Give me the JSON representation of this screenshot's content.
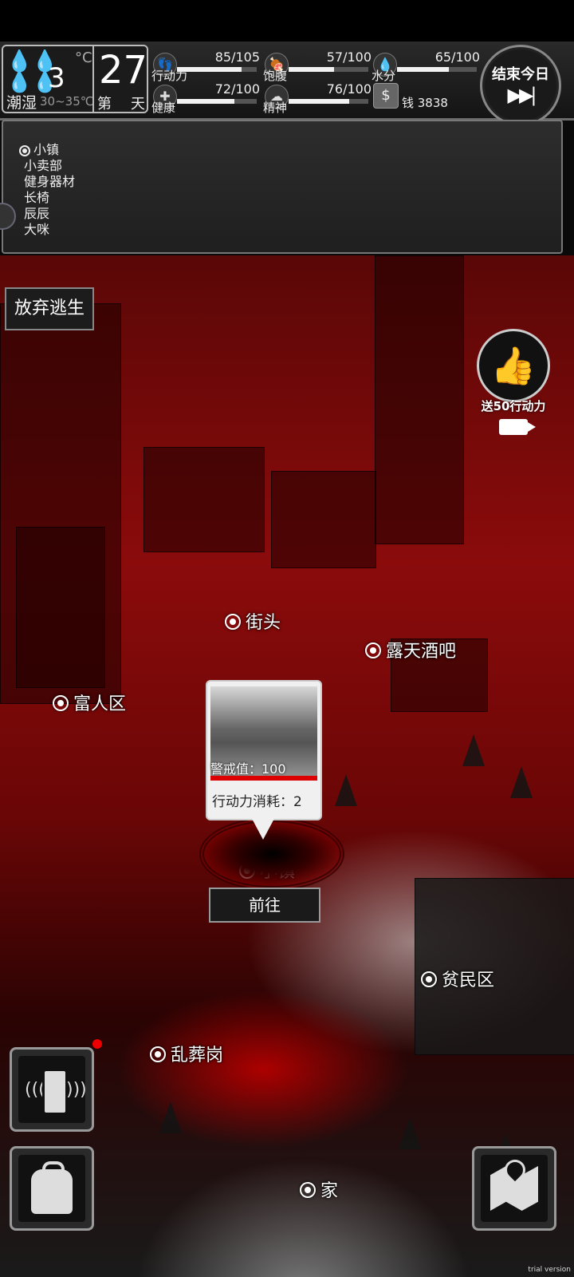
{
  "weather": {
    "drops_icon": "rain-drops-icon",
    "temperature": "3",
    "degree_unit": "°C",
    "humidity_label": "潮湿",
    "temp_range": "30~35℃"
  },
  "day": {
    "number": "27",
    "prefix": "第",
    "suffix": "天"
  },
  "stats": {
    "action": {
      "label": "行动力",
      "value": "85/105",
      "fraction": 0.81,
      "icon": "footprints-icon"
    },
    "satiety": {
      "label": "饱腹",
      "value": "57/100",
      "fraction": 0.57,
      "icon": "stomach-icon"
    },
    "water": {
      "label": "水分",
      "value": "65/100",
      "fraction": 0.65,
      "icon": "water-drop-icon"
    },
    "health": {
      "label": "健康",
      "value": "72/100",
      "fraction": 0.72,
      "icon": "medkit-icon"
    },
    "spirit": {
      "label": "精神",
      "value": "76/100",
      "fraction": 0.76,
      "icon": "brain-icon"
    }
  },
  "money": {
    "label": "钱 3838",
    "icon": "money-icon"
  },
  "end_day": {
    "label": "结束今日",
    "icon": "▶▶|"
  },
  "location_panel": {
    "current": "小镇",
    "items": [
      "小卖部",
      "健身器材",
      "长椅",
      "辰辰",
      "大咪"
    ]
  },
  "buttons": {
    "give_up": "放弃逃生",
    "go": "前往"
  },
  "ad_reward": {
    "label": "送50行动力",
    "icon": "thumbs-up-icon"
  },
  "markers": {
    "street": "街头",
    "bar": "露天酒吧",
    "rich": "富人区",
    "town": "小镇",
    "slum": "贫民区",
    "graveyard": "乱葬岗",
    "home": "家"
  },
  "popup": {
    "alert": "警戒值：100",
    "cost": "行动力消耗：2"
  },
  "watermark": "trial version"
}
